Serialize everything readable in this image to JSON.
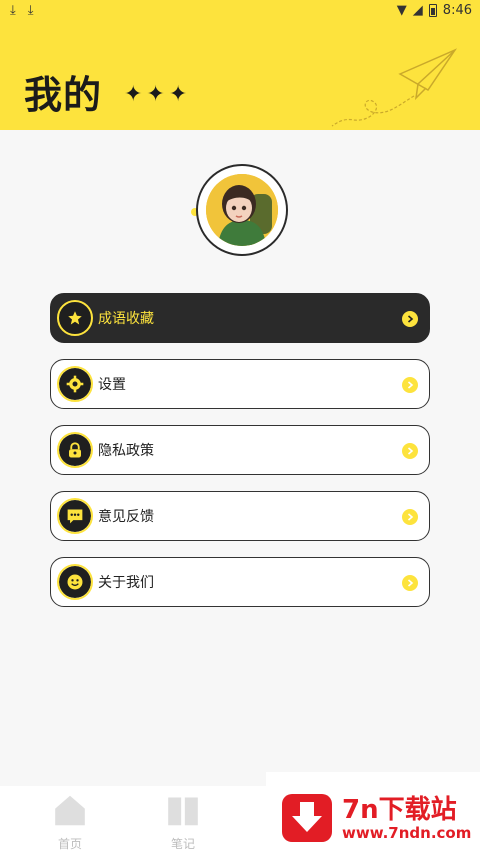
{
  "status": {
    "time": "8:46"
  },
  "header": {
    "title": "我的",
    "sparkles": "✦✦✦"
  },
  "menu": [
    {
      "label": "成语收藏",
      "icon": "star-icon",
      "active": true
    },
    {
      "label": "设置",
      "icon": "gear-icon"
    },
    {
      "label": "隐私政策",
      "icon": "lock-icon"
    },
    {
      "label": "意见反馈",
      "icon": "chat-icon"
    },
    {
      "label": "关于我们",
      "icon": "smile-icon"
    }
  ],
  "tabs": [
    {
      "label": "首页",
      "icon": "home-icon"
    },
    {
      "label": "笔记",
      "icon": "book-icon"
    }
  ],
  "watermark": {
    "title": "7n下载站",
    "url": "www.7ndn.com"
  },
  "colors": {
    "accent": "#fde33d",
    "dark": "#2a2a2a",
    "watermark": "#e21d25"
  }
}
